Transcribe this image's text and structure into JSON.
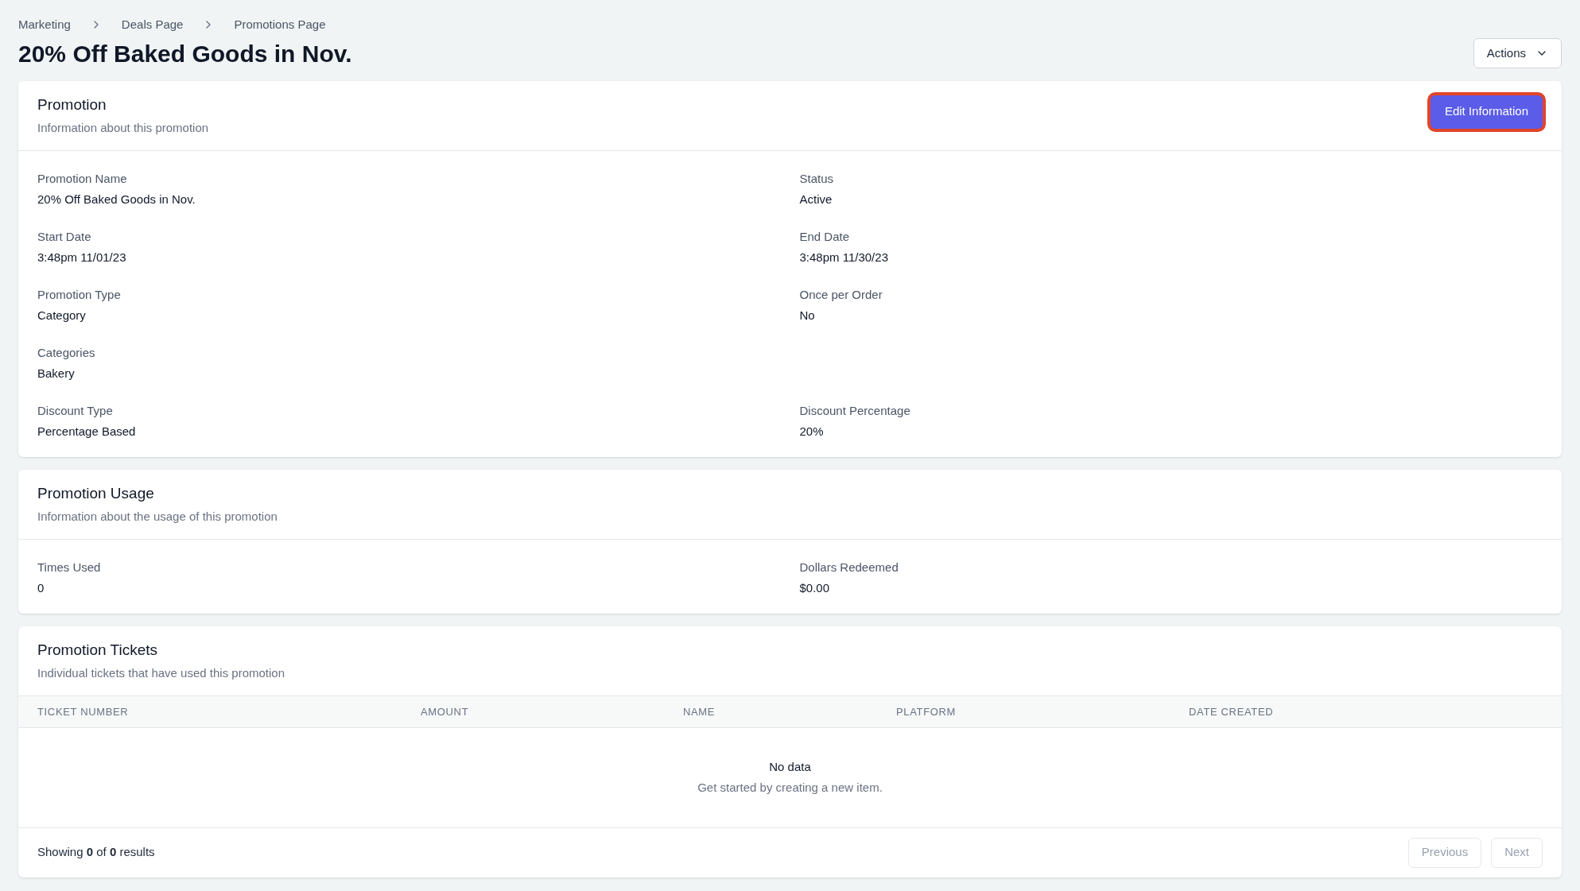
{
  "breadcrumbs": [
    "Marketing",
    "Deals Page",
    "Promotions Page"
  ],
  "title": "20% Off Baked Goods in Nov.",
  "actions_button": {
    "label": "Actions"
  },
  "promotion": {
    "title": "Promotion",
    "subtitle": "Information about this promotion",
    "edit_button": {
      "label": "Edit Information",
      "highlighted": true
    },
    "fields": [
      {
        "label": "Promotion Name",
        "value": "20% Off Baked Goods in Nov."
      },
      {
        "label": "Status",
        "value": "Active"
      },
      {
        "label": "Start Date",
        "value": "3:48pm 11/01/23"
      },
      {
        "label": "End Date",
        "value": "3:48pm 11/30/23"
      },
      {
        "label": "Promotion Type",
        "value": "Category"
      },
      {
        "label": "Once per Order",
        "value": "No"
      },
      {
        "label": "Categories",
        "value": "Bakery",
        "full_row": true
      },
      {
        "label": "Discount Type",
        "value": "Percentage Based"
      },
      {
        "label": "Discount Percentage",
        "value": "20%"
      }
    ]
  },
  "usage": {
    "title": "Promotion Usage",
    "subtitle": "Information about the usage of this promotion",
    "fields": [
      {
        "label": "Times Used",
        "value": "0"
      },
      {
        "label": "Dollars Redeemed",
        "value": "$0.00"
      }
    ]
  },
  "tickets": {
    "title": "Promotion Tickets",
    "subtitle": "Individual tickets that have used this promotion",
    "columns": [
      "TICKET NUMBER",
      "AMOUNT",
      "NAME",
      "PLATFORM",
      "DATE CREATED"
    ],
    "empty_title": "No data",
    "empty_text": "Get started by creating a new item.",
    "summary": "Showing **0** of **0** results",
    "buttons": [
      {
        "label": "Previous",
        "disabled": true
      },
      {
        "label": "Next",
        "disabled": true
      }
    ]
  }
}
